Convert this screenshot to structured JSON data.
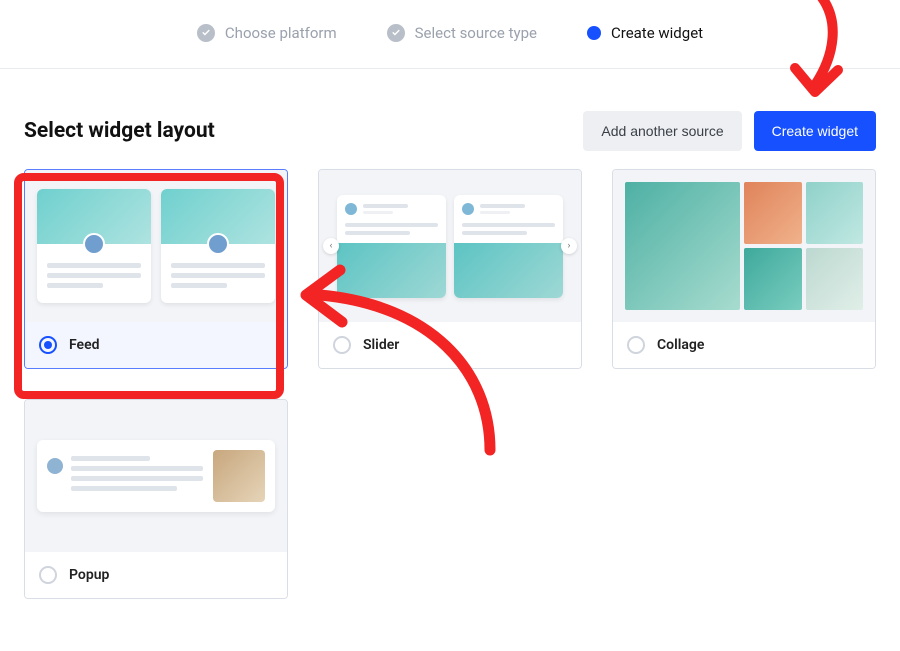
{
  "stepper": {
    "steps": [
      {
        "label": "Choose platform",
        "state": "done"
      },
      {
        "label": "Select source type",
        "state": "done"
      },
      {
        "label": "Create widget",
        "state": "active"
      }
    ]
  },
  "section_title": "Select widget layout",
  "actions": {
    "add_source_label": "Add another source",
    "create_widget_label": "Create widget"
  },
  "layouts": [
    {
      "name": "Feed",
      "selected": true
    },
    {
      "name": "Slider",
      "selected": false
    },
    {
      "name": "Collage",
      "selected": false
    },
    {
      "name": "Popup",
      "selected": false
    }
  ]
}
